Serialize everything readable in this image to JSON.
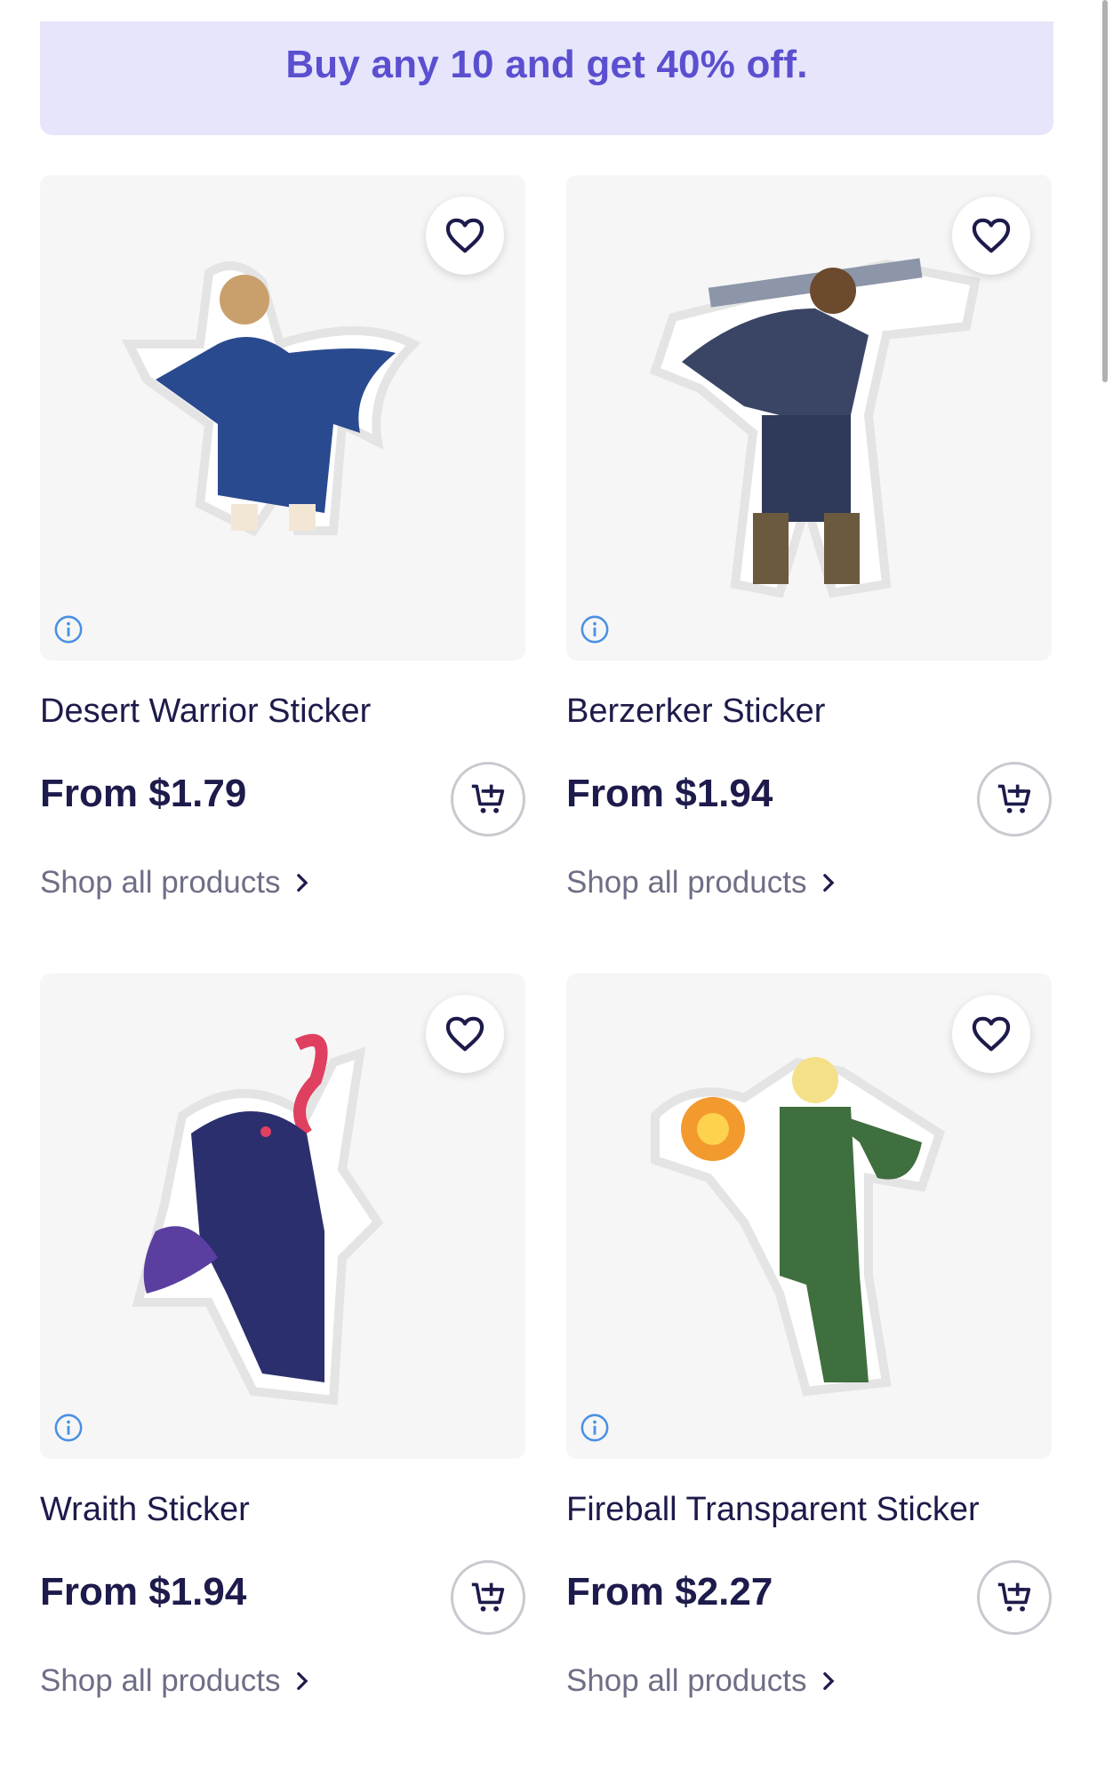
{
  "promo": {
    "text": "Buy any 10 and get 40% off."
  },
  "products": [
    {
      "title": "Desert Warrior Sticker",
      "price": "From $1.79",
      "shop_link": "Shop all products",
      "accent": "#2a4a8f",
      "accent2": "#c9a06b"
    },
    {
      "title": "Berzerker Sticker",
      "price": "From $1.94",
      "shop_link": "Shop all products",
      "accent": "#3a4566",
      "accent2": "#6b5a3e"
    },
    {
      "title": "Wraith Sticker",
      "price": "From $1.94",
      "shop_link": "Shop all products",
      "accent": "#2b2f6e",
      "accent2": "#e04060"
    },
    {
      "title": "Fireball Transparent Sticker",
      "price": "From $2.27",
      "shop_link": "Shop all products",
      "accent": "#3f6e3f",
      "accent2": "#f29a2e"
    }
  ],
  "colors": {
    "brand": "#5b4fd0",
    "promo_bg": "#e6e5fb",
    "text": "#1d1b4b",
    "muted": "#6e6e86",
    "info_icon": "#4a90e2"
  },
  "icons": {
    "favorite": "heart-icon",
    "info": "info-icon",
    "cart": "add-to-cart-icon",
    "chevron": "chevron-right-icon"
  }
}
